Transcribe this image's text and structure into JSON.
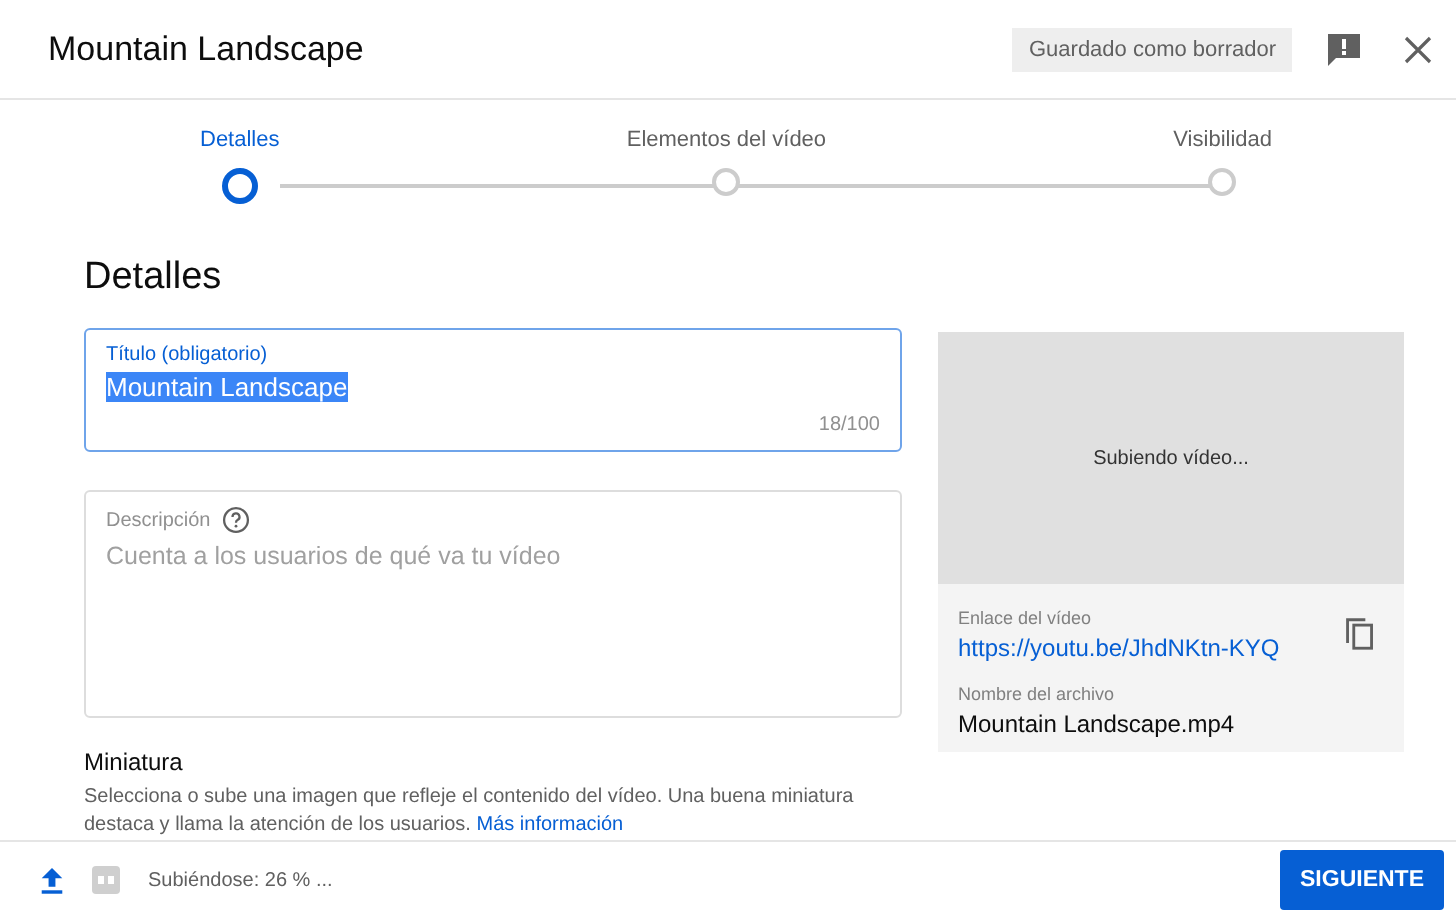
{
  "window": {
    "title": "Mountain Landscape",
    "draft_badge": "Guardado como borrador"
  },
  "steps": [
    {
      "label": "Detalles",
      "selected": true
    },
    {
      "label": "Elementos del vídeo",
      "selected": false
    },
    {
      "label": "Visibilidad",
      "selected": false
    }
  ],
  "section_title": "Detalles",
  "title_field": {
    "label": "Título (obligatorio)",
    "value": "Mountain Landscape",
    "counter": "18/100"
  },
  "description_field": {
    "label": "Descripción",
    "placeholder": "Cuenta a los usuarios de qué va tu vídeo"
  },
  "preview": {
    "status": "Subiendo vídeo...",
    "link_label": "Enlace del vídeo",
    "link": "https://youtu.be/JhdNKtn-KYQ",
    "file_label": "Nombre del archivo",
    "file_name": "Mountain Landscape.mp4"
  },
  "thumbnail": {
    "title": "Miniatura",
    "text": "Selecciona o sube una imagen que refleje el contenido del vídeo. Una buena miniatura destaca y llama la atención de los usuarios.",
    "link": "Más información"
  },
  "footer": {
    "status": "Subiéndose: 26 % ...",
    "next_button": "SIGUIENTE"
  }
}
